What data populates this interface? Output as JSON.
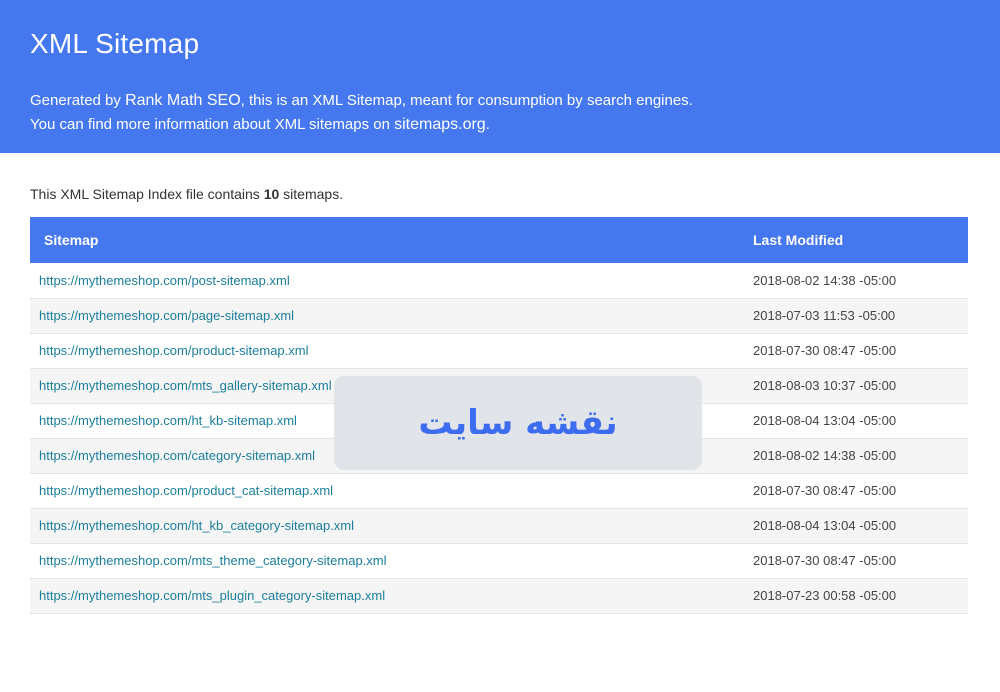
{
  "header": {
    "title": "XML Sitemap",
    "desc_line1_pre": "Generated by ",
    "desc_line1_link": "Rank Math SEO",
    "desc_line1_post": ", this is an XML Sitemap, meant for consumption by search engines.",
    "desc_line2_pre": "You can find more information about XML sitemaps on ",
    "desc_line2_link": "sitemaps.org",
    "desc_line2_post": ".",
    "background_color": "#4577ef"
  },
  "intro": {
    "pre": "This XML Sitemap Index file contains ",
    "count": "10",
    "post": " sitemaps."
  },
  "table": {
    "headers": {
      "sitemap": "Sitemap",
      "last_modified": "Last Modified"
    },
    "rows": [
      {
        "url": "https://mythemeshop.com/post-sitemap.xml",
        "date": "2018-08-02 14:38 -05:00"
      },
      {
        "url": "https://mythemeshop.com/page-sitemap.xml",
        "date": "2018-07-03 11:53 -05:00"
      },
      {
        "url": "https://mythemeshop.com/product-sitemap.xml",
        "date": "2018-07-30 08:47 -05:00"
      },
      {
        "url": "https://mythemeshop.com/mts_gallery-sitemap.xml",
        "date": "2018-08-03 10:37 -05:00"
      },
      {
        "url": "https://mythemeshop.com/ht_kb-sitemap.xml",
        "date": "2018-08-04 13:04 -05:00"
      },
      {
        "url": "https://mythemeshop.com/category-sitemap.xml",
        "date": "2018-08-02 14:38 -05:00"
      },
      {
        "url": "https://mythemeshop.com/product_cat-sitemap.xml",
        "date": "2018-07-30 08:47 -05:00"
      },
      {
        "url": "https://mythemeshop.com/ht_kb_category-sitemap.xml",
        "date": "2018-08-04 13:04 -05:00"
      },
      {
        "url": "https://mythemeshop.com/mts_theme_category-sitemap.xml",
        "date": "2018-07-30 08:47 -05:00"
      },
      {
        "url": "https://mythemeshop.com/mts_plugin_category-sitemap.xml",
        "date": "2018-07-23 00:58 -05:00"
      }
    ]
  },
  "overlay": {
    "text": "نقشه سایت"
  }
}
